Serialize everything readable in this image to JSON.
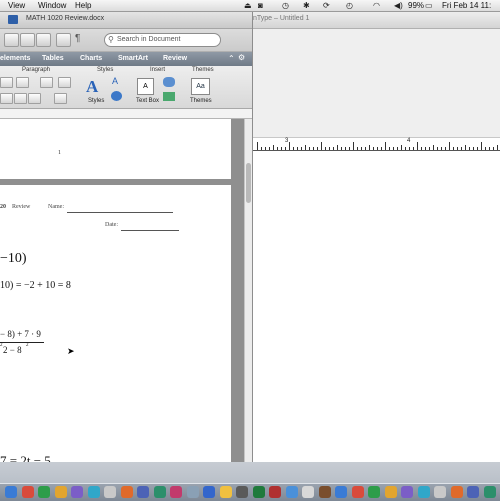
{
  "menubar": {
    "items": [
      "View",
      "Window",
      "Help"
    ],
    "battery": "99%",
    "clock": "Fri Feb 14 11:"
  },
  "word": {
    "title": "MATH 1020 Review.docx",
    "search_placeholder": "Search in Document",
    "ribbon_tabs": [
      "elements",
      "Tables",
      "Charts",
      "SmartArt",
      "Review"
    ],
    "groups": {
      "paragraph": "Paragraph",
      "styles": "Styles",
      "insert": "Insert",
      "themes": "Themes"
    },
    "buttons": {
      "styles": "Styles",
      "textbox": "Text Box",
      "themes": "Themes"
    },
    "page1_number": "1",
    "header": {
      "course": "20",
      "review": "Review",
      "name_label": "Name:",
      "date_label": "Date:"
    },
    "problems": {
      "p1": "−10)",
      "p2": "10) = −2 + 10 = 8",
      "p3_num": "− 8) + 7 · 9",
      "p3_den": "2 − 8",
      "p3_sup1": "2",
      "p3_sup2": "2",
      "p4": "7 = 2t − 5"
    }
  },
  "mathtype": {
    "title": "nType – Untitled 1",
    "ruler_labels": [
      "3",
      "4"
    ]
  },
  "colors": {
    "ribbon_tab_bg": "#7a8591",
    "menubar_bg": "#e8e8e8",
    "dock_bg": "#b8c0ca"
  }
}
